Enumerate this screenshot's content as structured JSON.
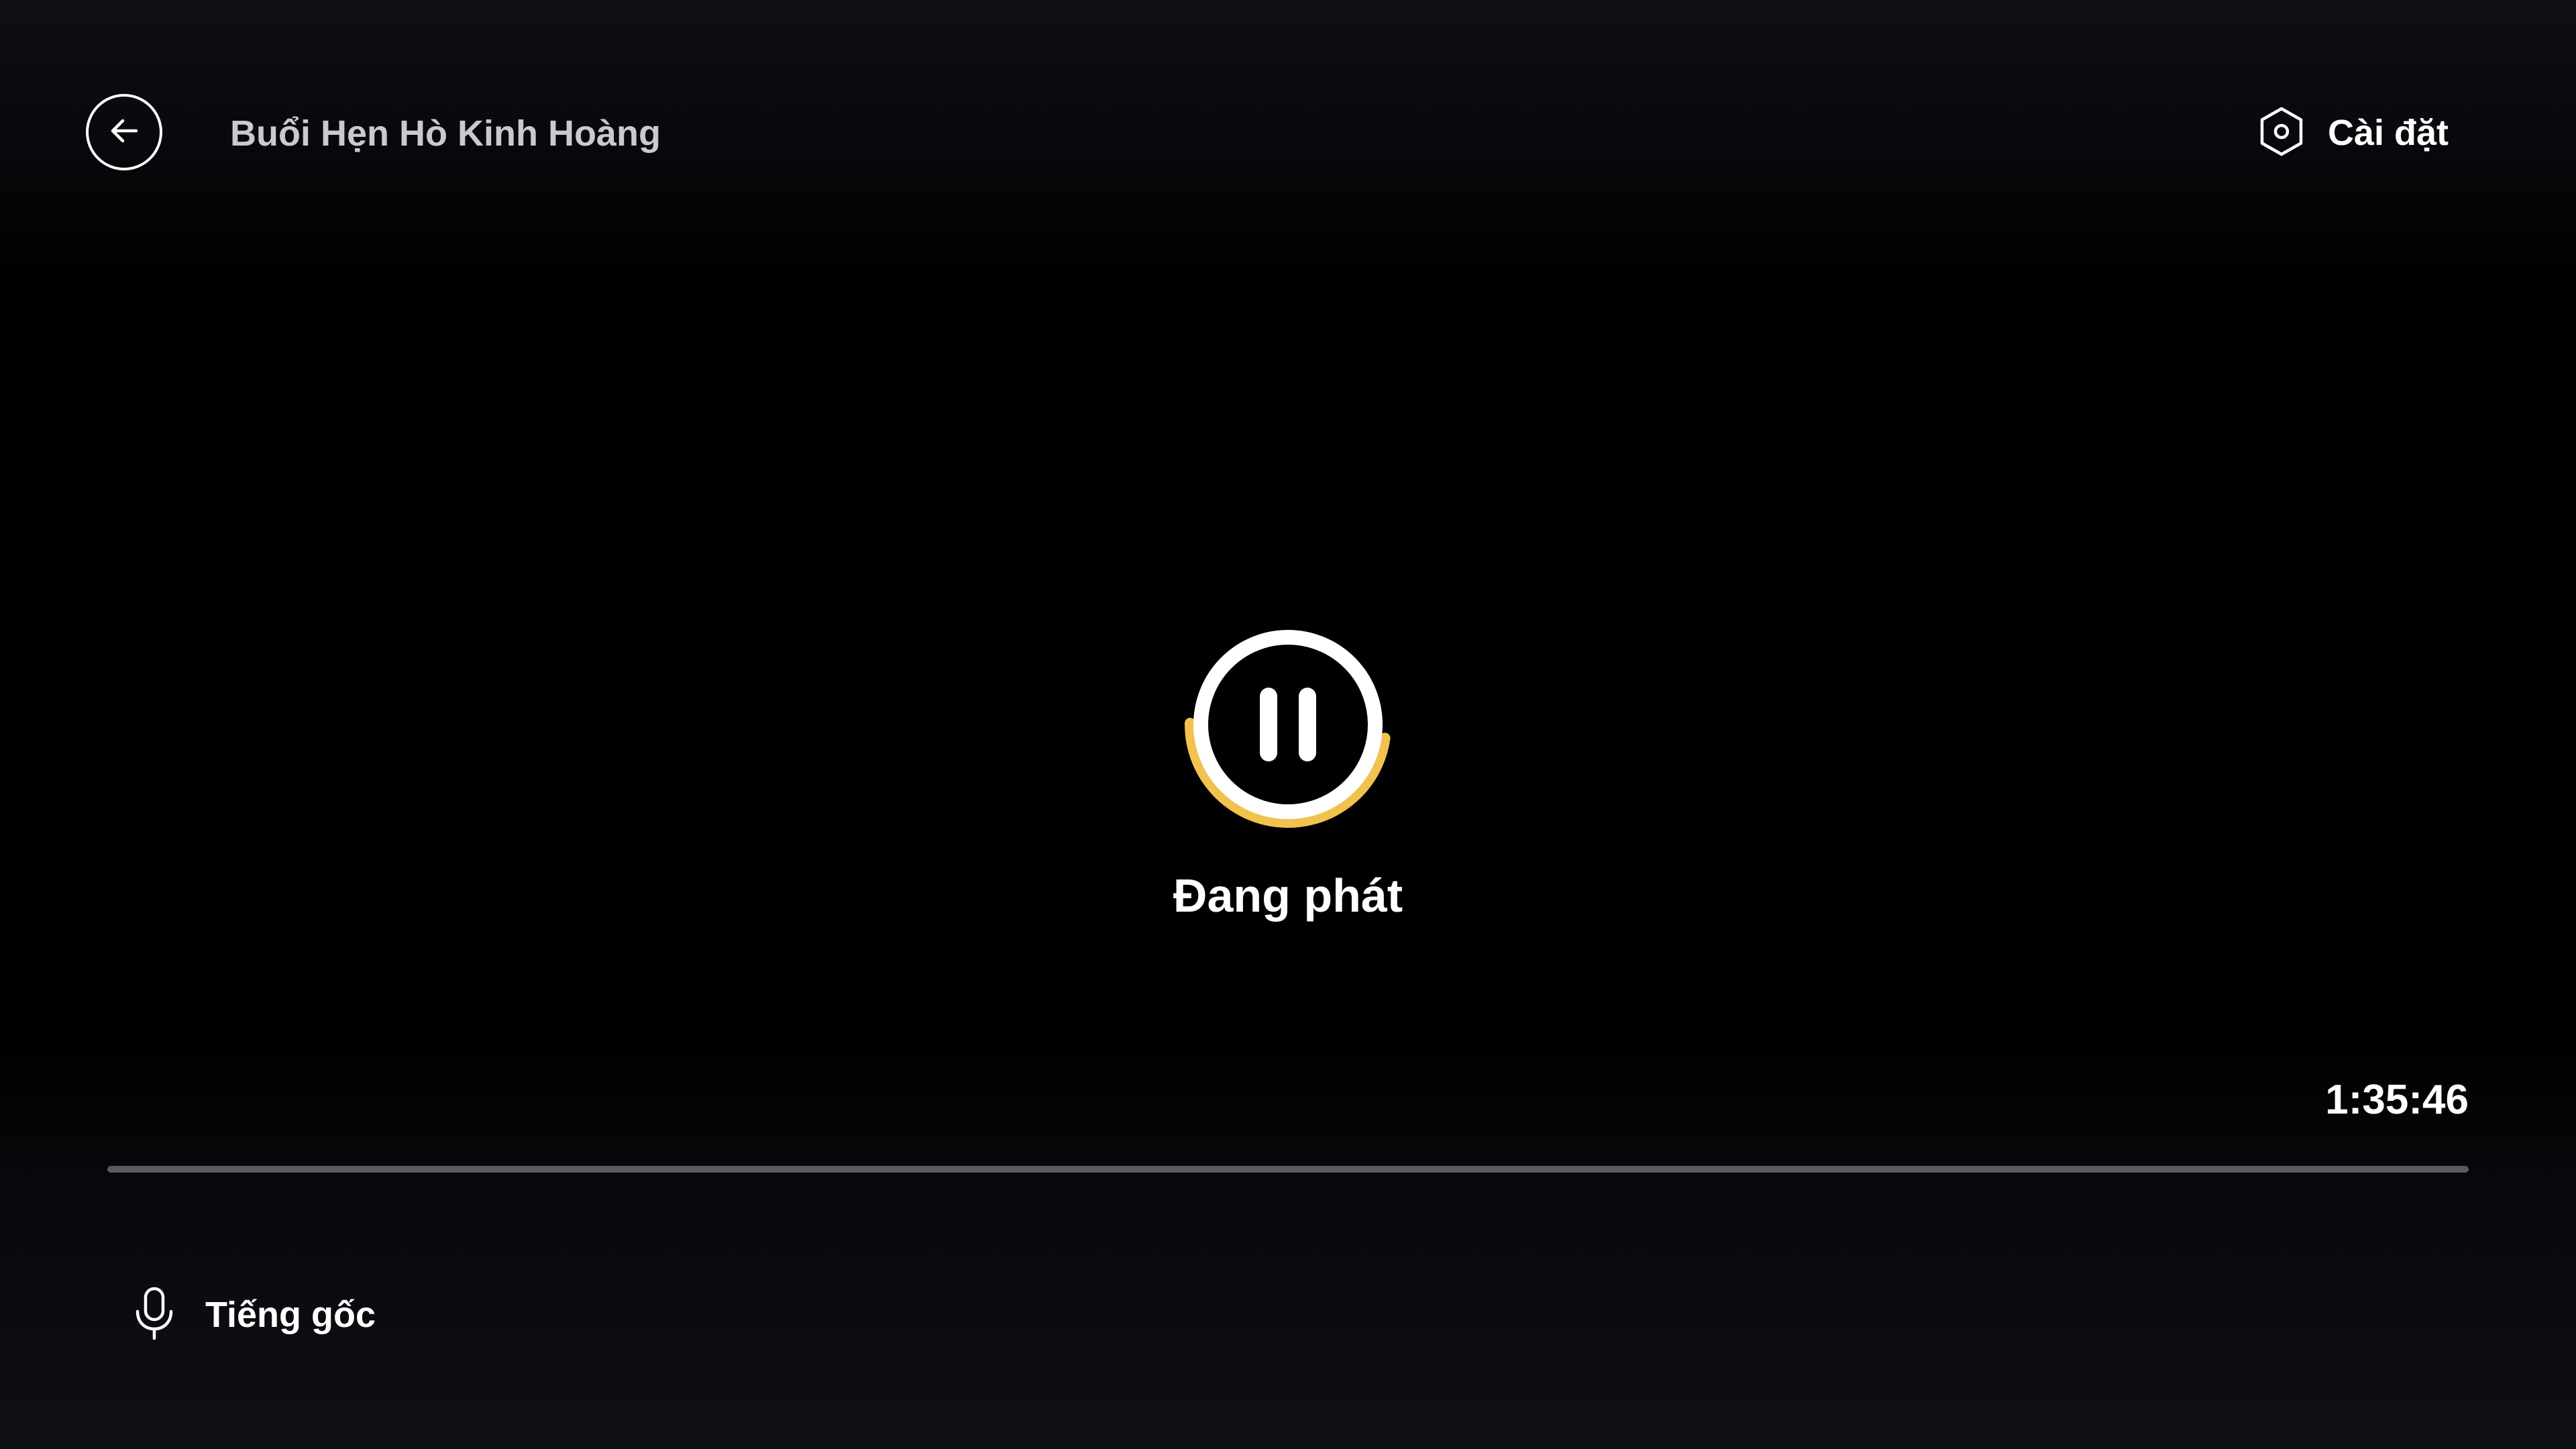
{
  "header": {
    "back_icon": "arrow-left-icon",
    "title": "Buổi Hẹn Hò Kinh Hoàng",
    "settings_icon": "hexagon-gear-icon",
    "settings_label": "Cài đặt"
  },
  "player": {
    "state_icon": "pause-icon",
    "status": "Đang phát",
    "time_remaining": "1:35:46",
    "progress_fraction": 0
  },
  "audio": {
    "icon": "microphone-icon",
    "label": "Tiếng gốc"
  },
  "colors": {
    "background": "#000000",
    "accent_ring": "#f2c24f",
    "title_text": "#c9c9ce",
    "progress_track": "#5a5a5e"
  }
}
